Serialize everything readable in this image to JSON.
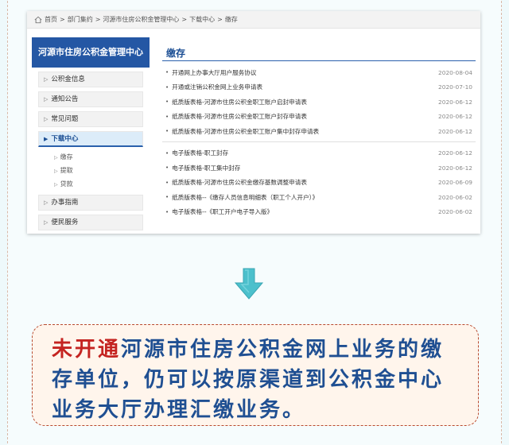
{
  "breadcrumb": {
    "items": [
      "首页",
      "部门集约",
      "河源市住房公积金管理中心",
      "下载中心",
      "缴存"
    ],
    "sep": ">"
  },
  "sidebar": {
    "title": "河源市住房公积金管理中心",
    "items": [
      {
        "label": "公积金信息"
      },
      {
        "label": "通知公告"
      },
      {
        "label": "常见问题"
      },
      {
        "label": "下载中心",
        "active": true
      },
      {
        "label": "办事指南"
      },
      {
        "label": "便民服务"
      }
    ],
    "subitems": [
      "缴存",
      "提取",
      "贷款"
    ]
  },
  "content": {
    "title": "缴存",
    "rows_group1": [
      {
        "title": "开通网上办事大厅用户服务协议",
        "date": "2020-08-04"
      },
      {
        "title": "开通或注销公积金网上业务申请表",
        "date": "2020-07-10"
      },
      {
        "title": "纸质版表格-河源市住房公积金职工账户启封申请表",
        "date": "2020-06-12"
      },
      {
        "title": "纸质版表格-河源市住房公积金职工账户封存申请表",
        "date": "2020-06-12"
      },
      {
        "title": "纸质版表格-河源市住房公积金职工账户集中封存申请表",
        "date": "2020-06-12"
      }
    ],
    "rows_group2": [
      {
        "title": "电子版表格-职工封存",
        "date": "2020-06-12"
      },
      {
        "title": "电子版表格-职工集中封存",
        "date": "2020-06-12"
      },
      {
        "title": "纸质版表格-河源市住房公积金缴存基数调整申请表",
        "date": "2020-06-09"
      },
      {
        "title": "纸质版表格--《缴存人员信息明细表（职工个人开户）》",
        "date": "2020-06-02"
      },
      {
        "title": "电子版表格--《职工开户电子导入版》",
        "date": "2020-06-02"
      }
    ]
  },
  "note": {
    "highlight": "未开通",
    "text": "河源市住房公积金网上业务的缴存单位，仍可以按原渠道到公积金中心业务大厅办理汇缴业务。"
  },
  "colors": {
    "accent_blue": "#2457a4",
    "note_text": "#1f4f92",
    "highlight_red": "#c42421",
    "note_border": "#b84a2f",
    "arrow": "#4cc0cc"
  },
  "icons": {
    "home": "home-icon",
    "arrow": "arrow-down-icon"
  }
}
